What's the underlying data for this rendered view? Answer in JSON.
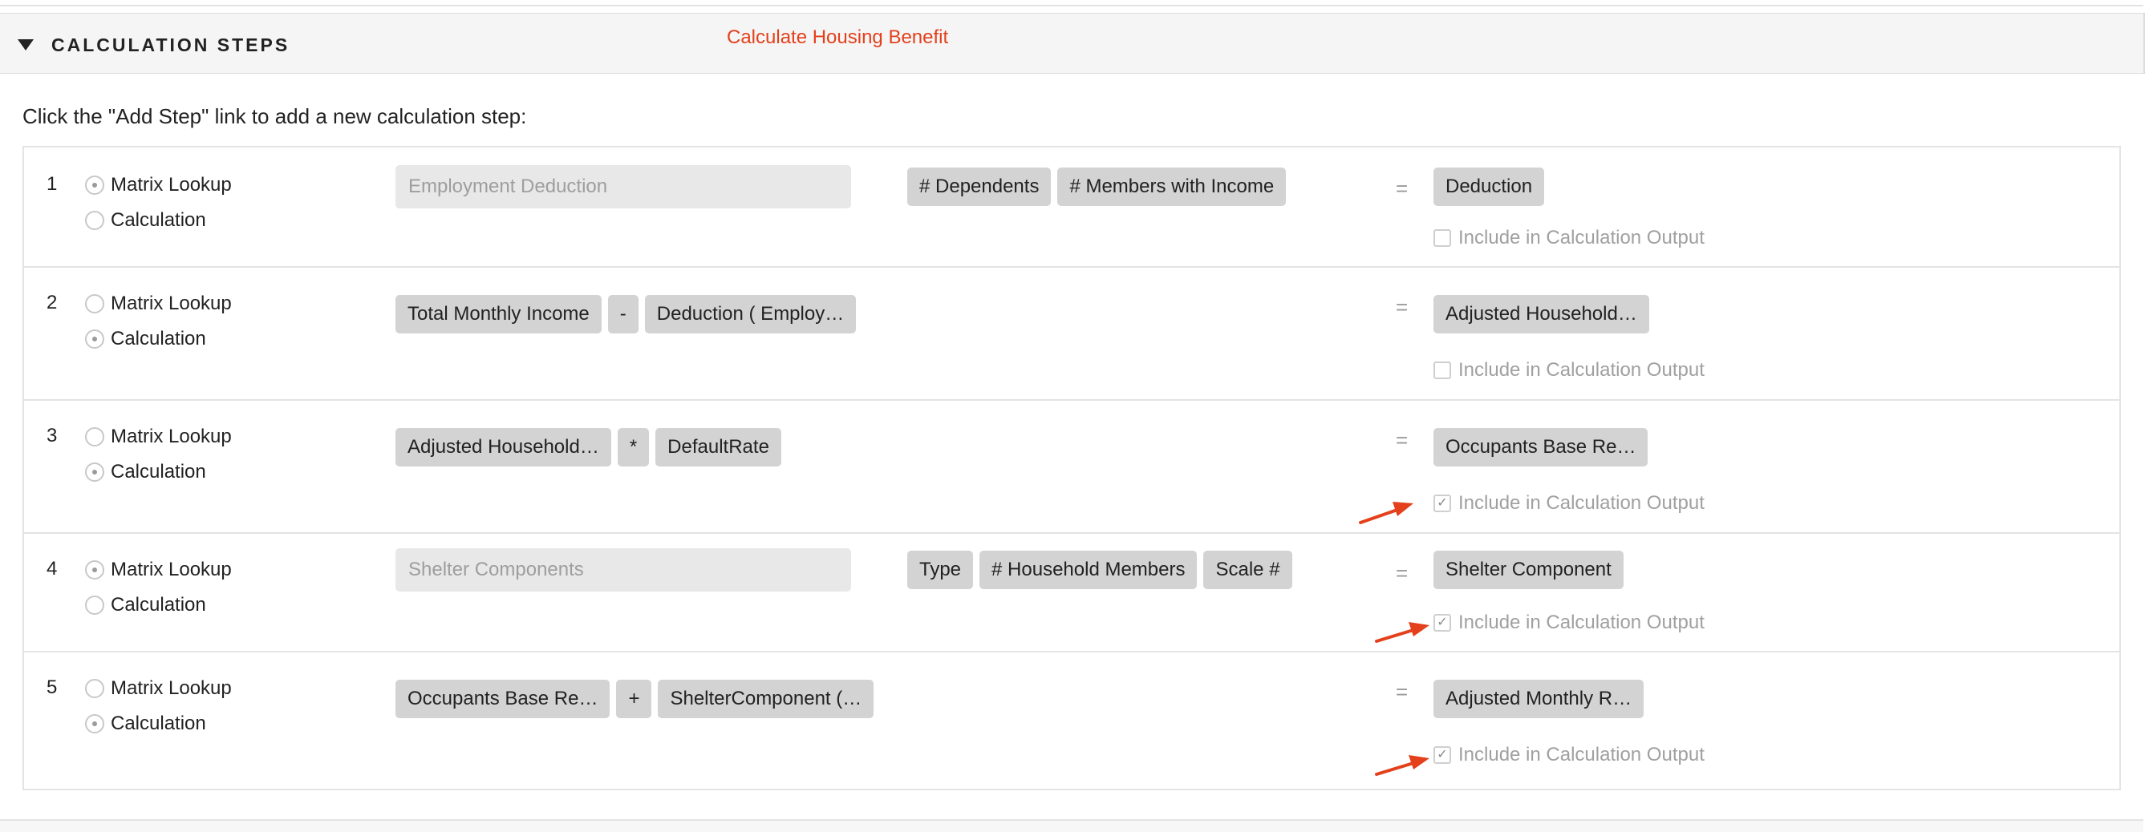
{
  "section": {
    "title": "CALCULATION STEPS",
    "subtitle": "Calculate Housing Benefit"
  },
  "instructions": "Click the \"Add Step\" link to add a new calculation step:",
  "radio_labels": {
    "matrix_lookup": "Matrix Lookup",
    "calculation": "Calculation"
  },
  "include_label": "Include in Calculation Output",
  "equals_sign": "=",
  "icons": {
    "collapse": "triangle-down-icon",
    "annotation": "red-arrow-icon",
    "check": "checkmark-icon"
  },
  "colors": {
    "accent_red": "#e3401b",
    "token_bg": "#d3d3d3",
    "input_bg": "#e8e8e8",
    "muted_text": "#a0a0a0"
  },
  "steps": [
    {
      "number": "1",
      "type_selected": "Matrix Lookup",
      "table_placeholder": "Employment Deduction",
      "tokens": [
        "# Dependents",
        "# Members with Income"
      ],
      "result": "Deduction",
      "include_checked": false
    },
    {
      "number": "2",
      "type_selected": "Calculation",
      "tokens": [
        "Total Monthly Income",
        "-",
        "Deduction ( Employ…"
      ],
      "result": "Adjusted Household…",
      "include_checked": false
    },
    {
      "number": "3",
      "type_selected": "Calculation",
      "tokens": [
        "Adjusted Household…",
        "*",
        "DefaultRate"
      ],
      "result": "Occupants Base Re…",
      "include_checked": true
    },
    {
      "number": "4",
      "type_selected": "Matrix Lookup",
      "table_placeholder": "Shelter Components",
      "tokens": [
        "Type",
        "# Household Members",
        "Scale #"
      ],
      "result": "Shelter Component",
      "include_checked": true
    },
    {
      "number": "5",
      "type_selected": "Calculation",
      "tokens": [
        "Occupants Base Re…",
        "+",
        "ShelterComponent (…"
      ],
      "result": "Adjusted Monthly R…",
      "include_checked": true
    }
  ]
}
